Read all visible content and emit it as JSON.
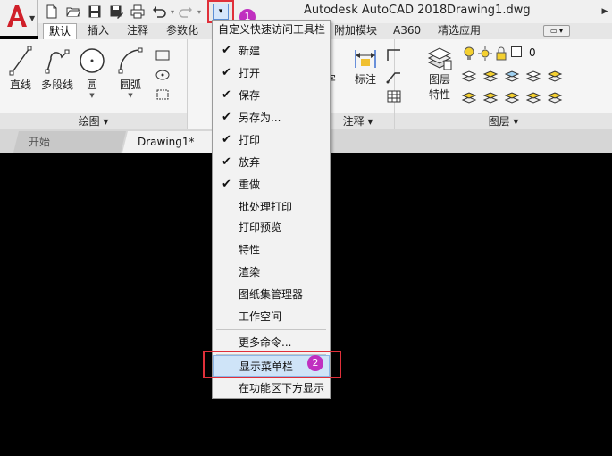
{
  "titlebar": {
    "app_name": "Autodesk AutoCAD 2018",
    "file_name": "Drawing1.dwg",
    "qat_dropdown_glyph": "▾",
    "callout_1": "1",
    "callout_2": "2",
    "qat_icons": [
      "new-file-icon",
      "open-folder-icon",
      "save-icon",
      "save-as-icon",
      "print-icon",
      "undo-icon",
      "redo-icon"
    ]
  },
  "ribbon_tabs": [
    {
      "label": "默认",
      "active": true
    },
    {
      "label": "插入"
    },
    {
      "label": "注释"
    },
    {
      "label": "参数化"
    },
    {
      "label": "附加模块"
    },
    {
      "label": "A360"
    },
    {
      "label": "精选应用"
    }
  ],
  "ribbon": {
    "draw": {
      "title": "绘图 ▾",
      "tools": [
        "直线",
        "多段线",
        "圆",
        "圆弧"
      ]
    },
    "annotation": {
      "title": "注释 ▾",
      "tools": [
        "字",
        "标注"
      ]
    },
    "layers": {
      "title": "图层 ▾",
      "tool": "图层",
      "tool_line2": "特性",
      "layer_value": "0"
    }
  },
  "doc_tabs": {
    "start": "开始",
    "drawing": "Drawing1*"
  },
  "menu": {
    "header": "自定义快速访问工具栏",
    "checked_items": [
      "新建",
      "打开",
      "保存",
      "另存为...",
      "打印",
      "放弃",
      "重做"
    ],
    "unchecked_items": [
      "批处理打印",
      "打印预览",
      "特性",
      "渲染",
      "图纸集管理器",
      "工作空间"
    ],
    "more_commands": "更多命令...",
    "show_menubar": "显示菜单栏",
    "show_below_ribbon": "在功能区下方显示",
    "check_glyph": "✔"
  },
  "colors": {
    "annotation_red": "#e0303a",
    "callout_magenta": "#c030c0",
    "highlight_blue": "#cfe4f8",
    "autocad_red": "#d0202a"
  }
}
